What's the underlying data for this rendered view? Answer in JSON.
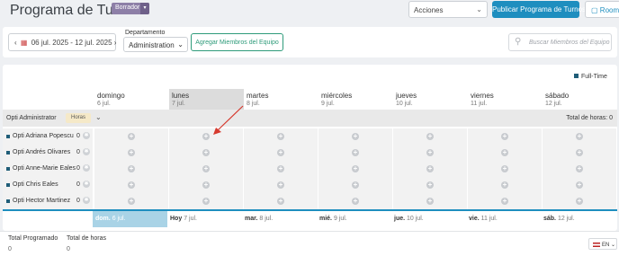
{
  "header": {
    "title": "Programa de Turnos",
    "status_badge": "Borrador",
    "actions_label": "Acciones",
    "publish_label": "Publicar Programa de Turnos",
    "room_label": "Room"
  },
  "filters": {
    "date_range": "06 jul. 2025 - 12 jul. 2025",
    "department_label": "Departamento",
    "department_value": "Administration",
    "add_members_label": "Agregar Miembros del Equipo",
    "search_placeholder": "Buscar Miembros del Equipo"
  },
  "legend": {
    "full_time": "Full-Time",
    "full_time_color": "#1f5d78"
  },
  "days": [
    {
      "name": "domingo",
      "date": "6 jul."
    },
    {
      "name": "lunes",
      "date": "7 jul."
    },
    {
      "name": "martes",
      "date": "8 jul."
    },
    {
      "name": "miércoles",
      "date": "9 jul."
    },
    {
      "name": "jueves",
      "date": "10 jul."
    },
    {
      "name": "viernes",
      "date": "11 jul."
    },
    {
      "name": "sábado",
      "date": "12 jul."
    }
  ],
  "group": {
    "name": "Opti Administrator",
    "hours_badge": "Horas",
    "total_hours": "Total de horas: 0"
  },
  "employees": [
    {
      "name": "Opti Adriana Popescu",
      "hours": "0"
    },
    {
      "name": "Opti Andrés Olivares",
      "hours": "0"
    },
    {
      "name": "Opti Anne-Marie Eales",
      "hours": "0"
    },
    {
      "name": "Opti Chris Eales",
      "hours": "0"
    },
    {
      "name": "Opti Hector Martinez",
      "hours": "0"
    }
  ],
  "footer_days": [
    {
      "abbr": "dom.",
      "date": "6 jul."
    },
    {
      "abbr": "Hoy",
      "date": "7 jul."
    },
    {
      "abbr": "mar.",
      "date": "8 jul."
    },
    {
      "abbr": "mié.",
      "date": "9 jul."
    },
    {
      "abbr": "jue.",
      "date": "10 jul."
    },
    {
      "abbr": "vie.",
      "date": "11 jul."
    },
    {
      "abbr": "sáb.",
      "date": "12 jul."
    }
  ],
  "totals": {
    "scheduled_label": "Total Programado",
    "scheduled_value": "0",
    "hours_label": "Total de horas",
    "hours_value": "0"
  },
  "language": "EN",
  "colors": {
    "accent": "#1e8ebf",
    "annotation_arrow": "#d63a2f"
  }
}
